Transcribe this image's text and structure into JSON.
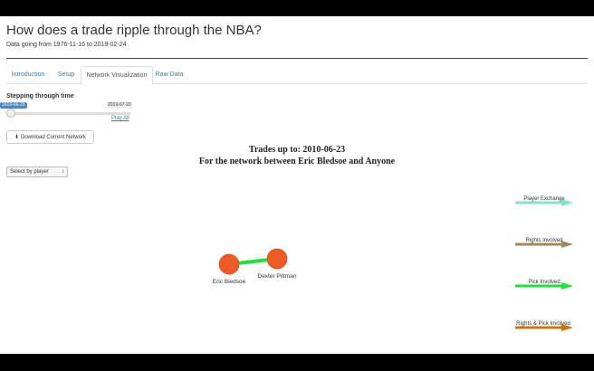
{
  "header": {
    "title": "How does a trade ripple through the NBA?",
    "subtitle": "Data going from 1976-11-16 to 2019-02-24"
  },
  "tabs": [
    {
      "label": "Introduction",
      "active": false
    },
    {
      "label": "Setup",
      "active": false
    },
    {
      "label": "Network Visualization",
      "active": true
    },
    {
      "label": "Raw Data",
      "active": false
    }
  ],
  "controls": {
    "stepping_label": "Stepping through time",
    "slider_from": "2010-06-23",
    "slider_to": "2019-07-20",
    "play_all": "Play All",
    "download_label": "Download Current Network",
    "select_value": "Select by player"
  },
  "network": {
    "title_line1": "Trades up to: 2010-06-23",
    "title_line2": "For the network between Eric Bledsoe and Anyone",
    "nodes": [
      {
        "label": "Eric Bledsoe"
      },
      {
        "label": "Dexter Pittman"
      }
    ],
    "legend": [
      {
        "label": "Player Exchange",
        "color": "#7fe5c0"
      },
      {
        "label": "Rights Involved",
        "color": "#a0895a"
      },
      {
        "label": "Pick Involved",
        "color": "#22e03a"
      },
      {
        "label": "Rights & Pick Involved",
        "color": "#c8780a"
      }
    ],
    "node_color": "#ef5a25",
    "edge_color": "#22e03a"
  }
}
